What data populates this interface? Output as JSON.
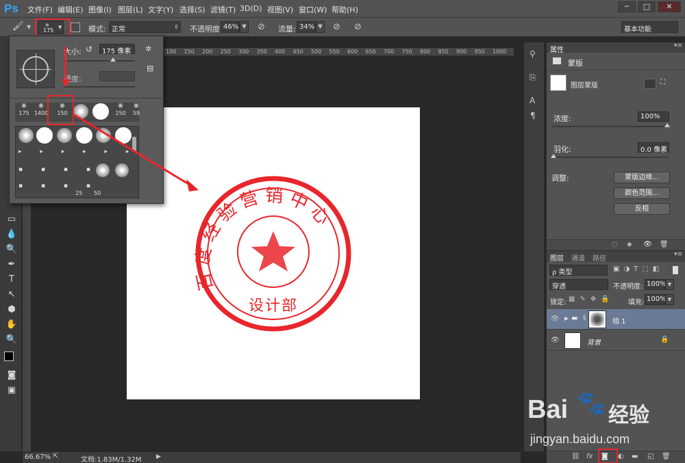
{
  "app": {
    "logo": "Ps",
    "window_controls": [
      "─",
      "□",
      "✕"
    ]
  },
  "menu": [
    "文件(F)",
    "编辑(E)",
    "图像(I)",
    "图层(L)",
    "文字(Y)",
    "选择(S)",
    "滤镜(T)",
    "3D(D)",
    "视图(V)",
    "窗口(W)",
    "帮助(H)"
  ],
  "options": {
    "brush_size": "175",
    "mode_label": "模式:",
    "mode_value": "正常",
    "opacity_label": "不透明度:",
    "opacity_value": "46%",
    "flow_label": "流量:",
    "flow_value": "34%",
    "workspace": "基本功能"
  },
  "brush_panel": {
    "size_label": "大小:",
    "size_value": "175 像素",
    "hardness_label": "硬度:",
    "presets_row1": [
      "175",
      "1400",
      "150",
      "",
      "",
      "250",
      "59"
    ],
    "presets_bottom": [
      "25",
      "50"
    ]
  },
  "ruler_marks": [
    "100",
    "150",
    "200",
    "250",
    "300",
    "350",
    "400",
    "450",
    "500",
    "550",
    "600",
    "650",
    "700",
    "750",
    "800",
    "850",
    "900",
    "950",
    "1000"
  ],
  "stamp": {
    "ring_text": "百度经验营销中心",
    "bottom_text": "设计部",
    "color": "#e8262b"
  },
  "status": {
    "zoom": "66.67%",
    "doc": "文档:1.83M/1.32M"
  },
  "properties": {
    "tab": "属性",
    "section": "蒙版",
    "mask_type": "图层蒙版",
    "density_label": "浓度:",
    "density_value": "100%",
    "feather_label": "羽化:",
    "feather_value": "0.0 像素",
    "adjust_label": "调整:",
    "buttons": [
      "蒙版边缘...",
      "颜色范围...",
      "反相"
    ]
  },
  "layers": {
    "tabs": [
      "图层",
      "通道",
      "路径"
    ],
    "kind_filter": "ρ 类型",
    "blend_mode": "穿透",
    "opacity_label": "不透明度:",
    "opacity_value": "100%",
    "lock_label": "锁定:",
    "fill_label": "填充:",
    "fill_value": "100%",
    "rows": [
      {
        "name": "组 1"
      },
      {
        "name": "背景"
      }
    ]
  },
  "watermark": {
    "brand": "Bai",
    "brand2": "经验",
    "url": "jingyan.baidu.com"
  }
}
